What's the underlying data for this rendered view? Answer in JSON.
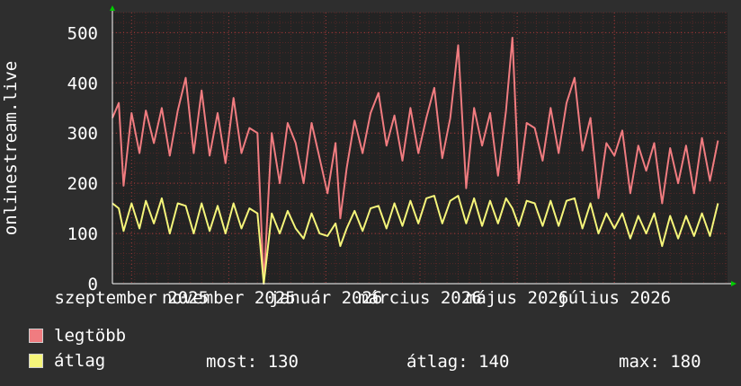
{
  "chart_data": {
    "type": "line",
    "ylabel": "onlinestream.live",
    "ylim": [
      0,
      540
    ],
    "yticks": [
      0,
      100,
      200,
      300,
      400,
      500
    ],
    "xlim": [
      "2025-08-20",
      "2026-09-10"
    ],
    "xtick_labels": [
      {
        "date": "2025-09-01",
        "label": "szeptember 2025"
      },
      {
        "date": "2025-11-01",
        "label": "november 2025"
      },
      {
        "date": "2026-01-01",
        "label": "január 2026"
      },
      {
        "date": "2026-03-01",
        "label": "március 2026"
      },
      {
        "date": "2026-05-01",
        "label": "május 2026"
      },
      {
        "date": "2026-07-01",
        "label": "július 2026"
      }
    ],
    "grid": true,
    "series": [
      {
        "name": "legtöbb",
        "color": "#f07c80",
        "points": [
          [
            "2025-08-20",
            330
          ],
          [
            "2025-08-24",
            360
          ],
          [
            "2025-08-27",
            195
          ],
          [
            "2025-09-01",
            340
          ],
          [
            "2025-09-06",
            260
          ],
          [
            "2025-09-10",
            345
          ],
          [
            "2025-09-15",
            280
          ],
          [
            "2025-09-20",
            350
          ],
          [
            "2025-09-25",
            255
          ],
          [
            "2025-09-30",
            345
          ],
          [
            "2025-10-05",
            410
          ],
          [
            "2025-10-10",
            260
          ],
          [
            "2025-10-15",
            385
          ],
          [
            "2025-10-20",
            255
          ],
          [
            "2025-10-25",
            340
          ],
          [
            "2025-10-30",
            240
          ],
          [
            "2025-11-04",
            370
          ],
          [
            "2025-11-09",
            260
          ],
          [
            "2025-11-14",
            310
          ],
          [
            "2025-11-19",
            300
          ],
          [
            "2025-11-23",
            0
          ],
          [
            "2025-11-28",
            300
          ],
          [
            "2025-12-03",
            200
          ],
          [
            "2025-12-08",
            320
          ],
          [
            "2025-12-13",
            280
          ],
          [
            "2025-12-18",
            200
          ],
          [
            "2025-12-23",
            320
          ],
          [
            "2025-12-28",
            250
          ],
          [
            "2026-01-02",
            180
          ],
          [
            "2026-01-07",
            280
          ],
          [
            "2026-01-10",
            130
          ],
          [
            "2026-01-14",
            230
          ],
          [
            "2026-01-19",
            325
          ],
          [
            "2026-01-24",
            260
          ],
          [
            "2026-01-29",
            340
          ],
          [
            "2026-02-03",
            380
          ],
          [
            "2026-02-08",
            275
          ],
          [
            "2026-02-13",
            335
          ],
          [
            "2026-02-18",
            245
          ],
          [
            "2026-02-23",
            350
          ],
          [
            "2026-02-28",
            260
          ],
          [
            "2026-03-05",
            330
          ],
          [
            "2026-03-10",
            390
          ],
          [
            "2026-03-15",
            250
          ],
          [
            "2026-03-20",
            330
          ],
          [
            "2026-03-25",
            475
          ],
          [
            "2026-03-30",
            190
          ],
          [
            "2026-04-04",
            350
          ],
          [
            "2026-04-09",
            275
          ],
          [
            "2026-04-14",
            340
          ],
          [
            "2026-04-19",
            215
          ],
          [
            "2026-04-24",
            345
          ],
          [
            "2026-04-28",
            490
          ],
          [
            "2026-05-02",
            200
          ],
          [
            "2026-05-07",
            320
          ],
          [
            "2026-05-12",
            310
          ],
          [
            "2026-05-17",
            245
          ],
          [
            "2026-05-22",
            350
          ],
          [
            "2026-05-27",
            260
          ],
          [
            "2026-06-01",
            360
          ],
          [
            "2026-06-06",
            410
          ],
          [
            "2026-06-11",
            265
          ],
          [
            "2026-06-16",
            330
          ],
          [
            "2026-06-21",
            170
          ],
          [
            "2026-06-26",
            280
          ],
          [
            "2026-07-01",
            255
          ],
          [
            "2026-07-06",
            305
          ],
          [
            "2026-07-11",
            180
          ],
          [
            "2026-07-16",
            275
          ],
          [
            "2026-07-21",
            225
          ],
          [
            "2026-07-26",
            280
          ],
          [
            "2026-07-31",
            160
          ],
          [
            "2026-08-05",
            270
          ],
          [
            "2026-08-10",
            200
          ],
          [
            "2026-08-15",
            275
          ],
          [
            "2026-08-20",
            180
          ],
          [
            "2026-08-25",
            290
          ],
          [
            "2026-08-30",
            205
          ],
          [
            "2026-09-04",
            285
          ]
        ]
      },
      {
        "name": "átlag",
        "color": "#f5f57a",
        "points": [
          [
            "2025-08-20",
            160
          ],
          [
            "2025-08-24",
            150
          ],
          [
            "2025-08-27",
            105
          ],
          [
            "2025-09-01",
            160
          ],
          [
            "2025-09-06",
            110
          ],
          [
            "2025-09-10",
            165
          ],
          [
            "2025-09-15",
            120
          ],
          [
            "2025-09-20",
            170
          ],
          [
            "2025-09-25",
            100
          ],
          [
            "2025-09-30",
            160
          ],
          [
            "2025-10-05",
            155
          ],
          [
            "2025-10-10",
            100
          ],
          [
            "2025-10-15",
            160
          ],
          [
            "2025-10-20",
            105
          ],
          [
            "2025-10-25",
            155
          ],
          [
            "2025-10-30",
            100
          ],
          [
            "2025-11-04",
            160
          ],
          [
            "2025-11-09",
            110
          ],
          [
            "2025-11-14",
            150
          ],
          [
            "2025-11-19",
            140
          ],
          [
            "2025-11-23",
            0
          ],
          [
            "2025-11-28",
            140
          ],
          [
            "2025-12-03",
            100
          ],
          [
            "2025-12-08",
            145
          ],
          [
            "2025-12-13",
            110
          ],
          [
            "2025-12-18",
            90
          ],
          [
            "2025-12-23",
            140
          ],
          [
            "2025-12-28",
            100
          ],
          [
            "2026-01-02",
            95
          ],
          [
            "2026-01-07",
            120
          ],
          [
            "2026-01-10",
            75
          ],
          [
            "2026-01-14",
            110
          ],
          [
            "2026-01-19",
            145
          ],
          [
            "2026-01-24",
            105
          ],
          [
            "2026-01-29",
            150
          ],
          [
            "2026-02-03",
            155
          ],
          [
            "2026-02-08",
            110
          ],
          [
            "2026-02-13",
            160
          ],
          [
            "2026-02-18",
            115
          ],
          [
            "2026-02-23",
            165
          ],
          [
            "2026-02-28",
            120
          ],
          [
            "2026-03-05",
            170
          ],
          [
            "2026-03-10",
            175
          ],
          [
            "2026-03-15",
            120
          ],
          [
            "2026-03-20",
            165
          ],
          [
            "2026-03-25",
            175
          ],
          [
            "2026-03-30",
            120
          ],
          [
            "2026-04-04",
            170
          ],
          [
            "2026-04-09",
            115
          ],
          [
            "2026-04-14",
            165
          ],
          [
            "2026-04-19",
            120
          ],
          [
            "2026-04-24",
            170
          ],
          [
            "2026-04-28",
            150
          ],
          [
            "2026-05-02",
            115
          ],
          [
            "2026-05-07",
            165
          ],
          [
            "2026-05-12",
            160
          ],
          [
            "2026-05-17",
            115
          ],
          [
            "2026-05-22",
            165
          ],
          [
            "2026-05-27",
            115
          ],
          [
            "2026-06-01",
            165
          ],
          [
            "2026-06-06",
            170
          ],
          [
            "2026-06-11",
            110
          ],
          [
            "2026-06-16",
            160
          ],
          [
            "2026-06-21",
            100
          ],
          [
            "2026-06-26",
            140
          ],
          [
            "2026-07-01",
            110
          ],
          [
            "2026-07-06",
            140
          ],
          [
            "2026-07-11",
            90
          ],
          [
            "2026-07-16",
            135
          ],
          [
            "2026-07-21",
            100
          ],
          [
            "2026-07-26",
            140
          ],
          [
            "2026-07-31",
            75
          ],
          [
            "2026-08-05",
            135
          ],
          [
            "2026-08-10",
            90
          ],
          [
            "2026-08-15",
            135
          ],
          [
            "2026-08-20",
            95
          ],
          [
            "2026-08-25",
            140
          ],
          [
            "2026-08-30",
            95
          ],
          [
            "2026-09-04",
            160
          ]
        ]
      }
    ]
  },
  "legend": {
    "max_label": "legtöbb",
    "avg_label": "átlag",
    "max_color": "#f07c80",
    "avg_color": "#f5f57a"
  },
  "stats": {
    "current": "most: 130",
    "average": "átlag: 140",
    "maximum": "max: 180"
  },
  "colors": {
    "background": "#2e2e2e",
    "plot_background": "#232323",
    "axis": "#ffffff",
    "grid": "#6b2a2a",
    "arrow": "#00cc00"
  }
}
